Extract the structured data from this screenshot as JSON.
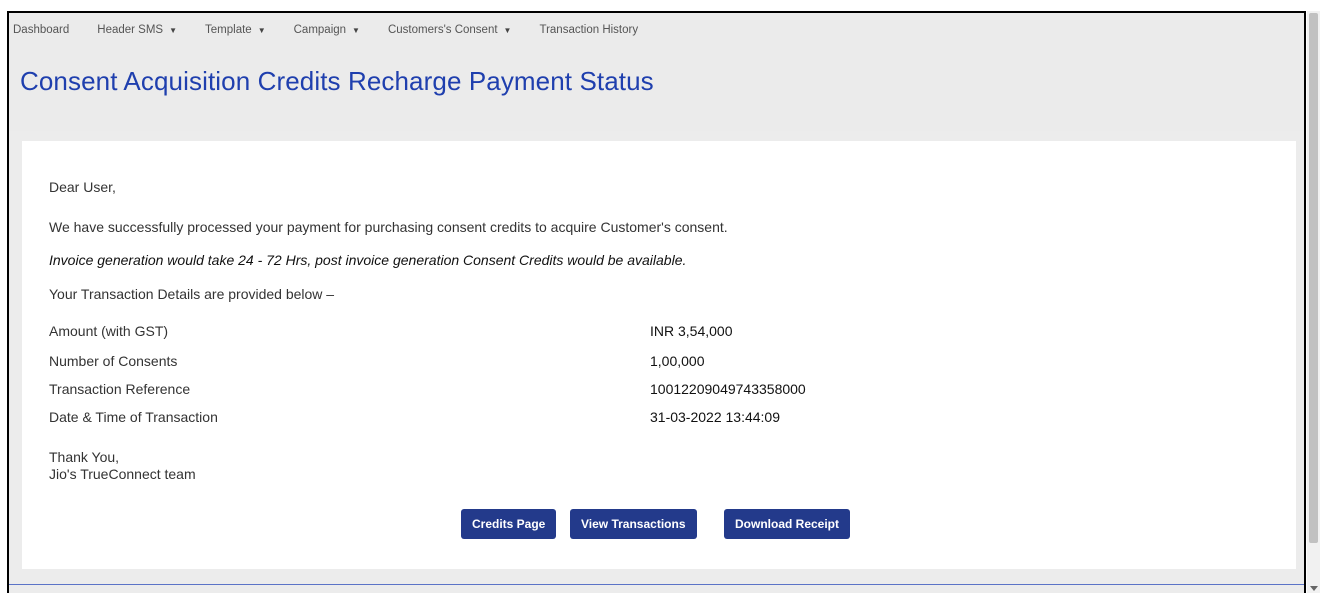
{
  "nav": {
    "items": [
      {
        "label": "Dashboard",
        "dropdown": false
      },
      {
        "label": "Header SMS",
        "dropdown": true
      },
      {
        "label": "Template",
        "dropdown": true
      },
      {
        "label": "Campaign",
        "dropdown": true
      },
      {
        "label": "Customers's Consent",
        "dropdown": true
      },
      {
        "label": "Transaction History",
        "dropdown": false
      }
    ],
    "caret": "▼"
  },
  "page": {
    "title": "Consent Acquisition Credits Recharge Payment Status"
  },
  "message": {
    "greeting": "Dear User,",
    "body": "We have successfully processed your payment for purchasing consent credits to acquire Customer's consent.",
    "invoice_note": "Invoice generation would take 24 - 72 Hrs, post invoice generation Consent Credits would be available.",
    "details_intro": "Your Transaction Details are provided below –"
  },
  "details": [
    {
      "label": "Amount (with GST)",
      "value": "INR 3,54,000"
    },
    {
      "label": "Number of Consents",
      "value": "1,00,000"
    },
    {
      "label": "Transaction Reference",
      "value": "10012209049743358000"
    },
    {
      "label": "Date & Time of Transaction",
      "value": "31-03-2022 13:44:09"
    }
  ],
  "signoff": {
    "thanks": "Thank You,",
    "team": "Jio's TrueConnect team"
  },
  "buttons": {
    "credits": "Credits Page",
    "transactions": "View Transactions",
    "receipt": "Download Receipt"
  },
  "colors": {
    "accent": "#1f3fae",
    "button": "#233a8b",
    "background": "#ececec"
  }
}
